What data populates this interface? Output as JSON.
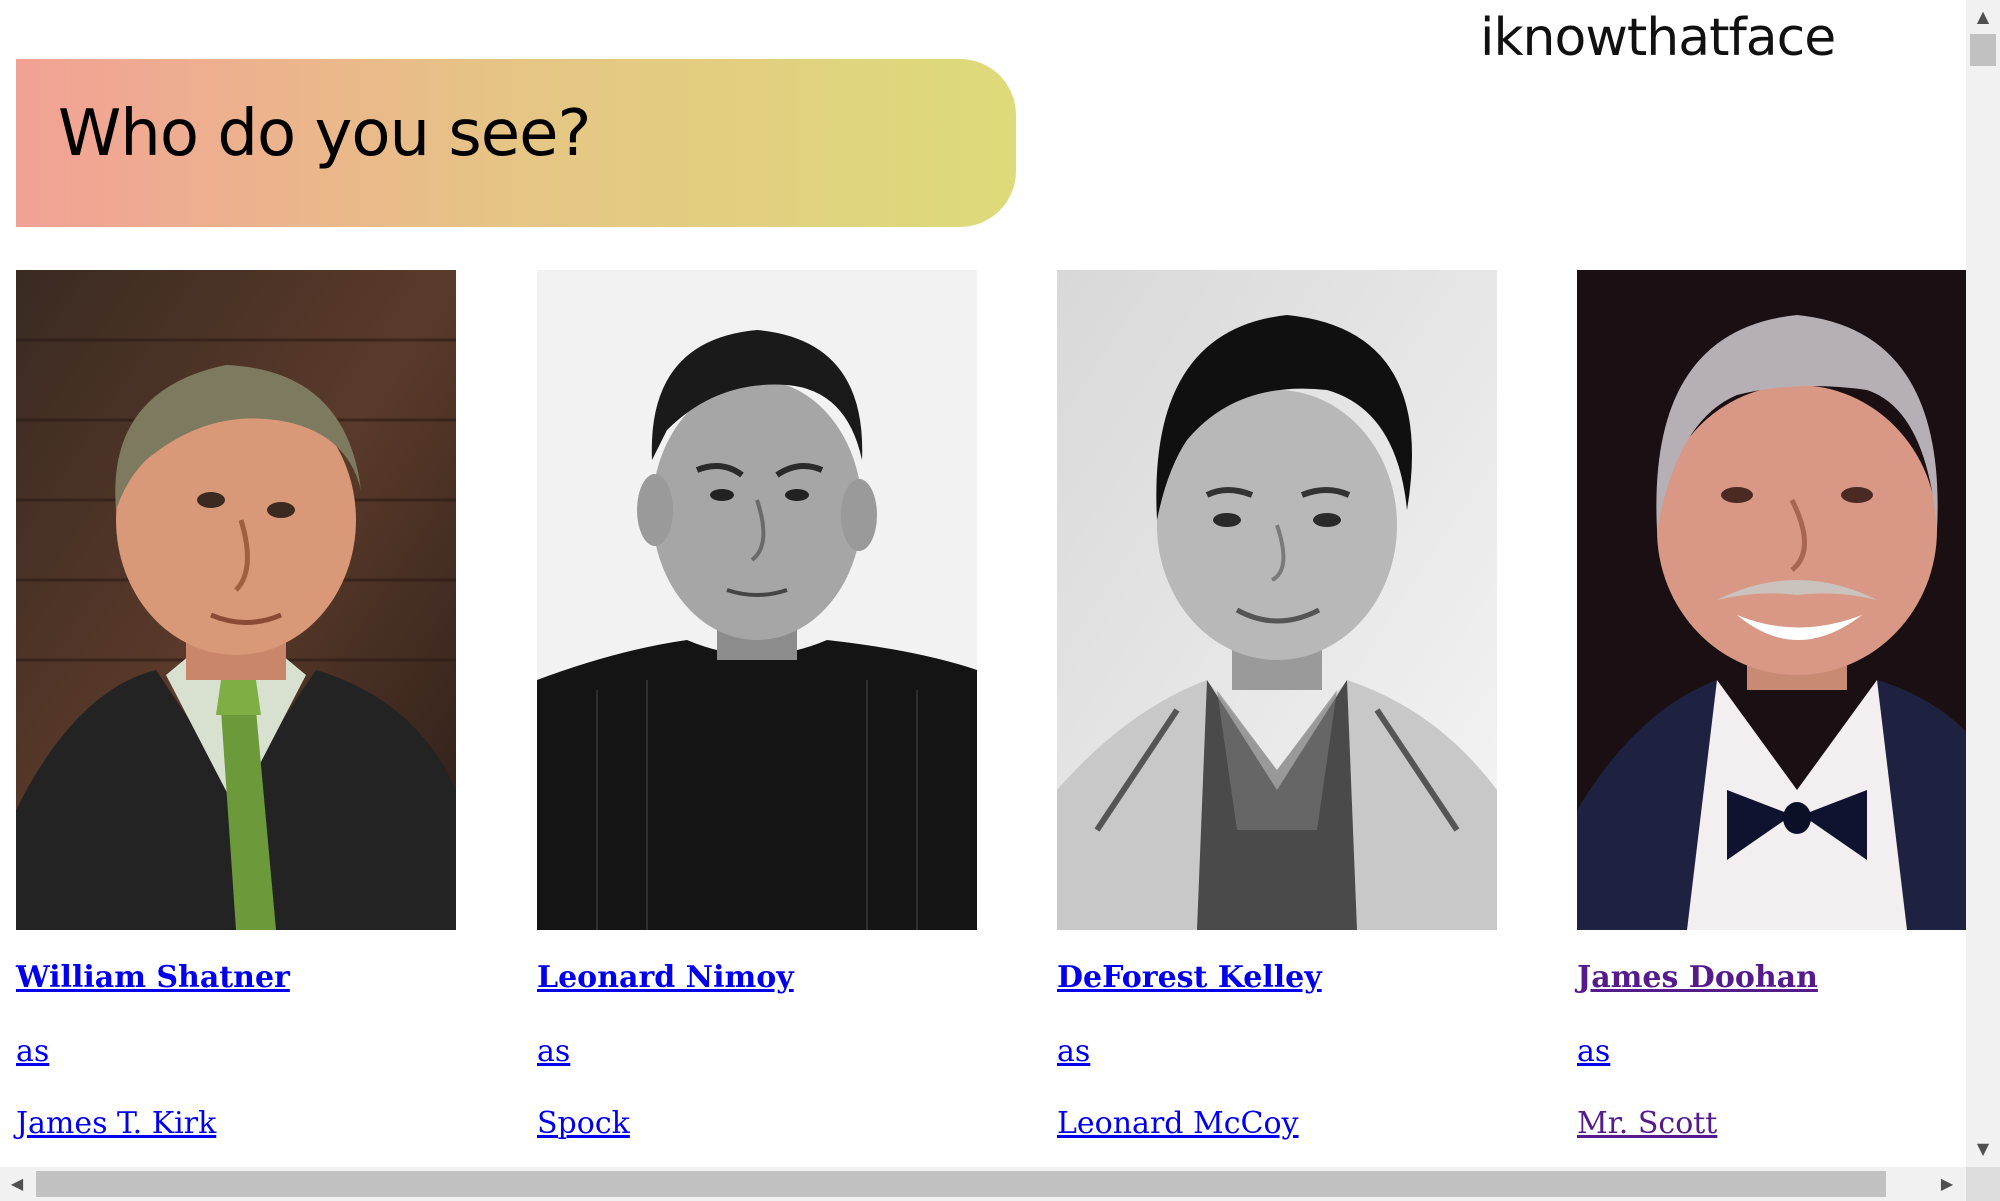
{
  "brand": "iknowthatface",
  "heading": "Who do you see?",
  "cards": [
    {
      "actor": "William Shatner",
      "as": "as",
      "role": "James T. Kirk",
      "visited": false
    },
    {
      "actor": "Leonard Nimoy",
      "as": "as",
      "role": "Spock",
      "visited": false
    },
    {
      "actor": "DeForest Kelley",
      "as": "as",
      "role": "Leonard McCoy",
      "visited": false
    },
    {
      "actor": "James Doohan",
      "as": "as",
      "role": "Mr. Scott",
      "visited": true
    }
  ],
  "colors": {
    "link": "#0000ee",
    "link_visited": "#551a8b",
    "banner_start": "#f2a195",
    "banner_end": "#dddb7a"
  },
  "icons": {
    "scroll_up": "▲",
    "scroll_down": "▼",
    "scroll_left": "◀",
    "scroll_right": "▶"
  }
}
